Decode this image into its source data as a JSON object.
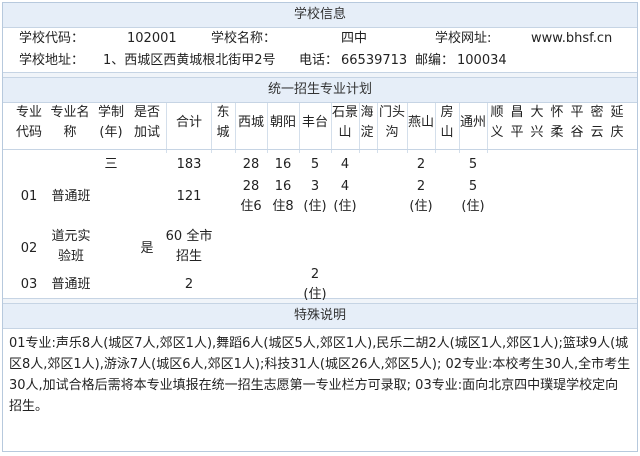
{
  "school_info": {
    "header": "学校信息",
    "code_label": "学校代码：",
    "code": "102001",
    "name_label": "学校名称：",
    "name": "四中",
    "url_label": "学校网址:",
    "url": "www.bhsf.cn",
    "address_label": "学校地址：",
    "address": "1、西城区西黄城根北街甲2号",
    "phone_label": "电话：",
    "phone": "66539713",
    "postal_label": "邮编：",
    "postal": "100034"
  },
  "plan": {
    "header": "统一招生专业计划",
    "columns": {
      "code": [
        "专业",
        "代码"
      ],
      "name": [
        "专业名",
        "称"
      ],
      "term": [
        "学制",
        "(年)"
      ],
      "exam": [
        "是否",
        "加试"
      ],
      "total": "合计",
      "dongcheng": [
        "东",
        "城"
      ],
      "xicheng": "西城",
      "chaoyang": "朝阳",
      "fengtai": "丰台",
      "shijingshan": [
        "石景",
        "山"
      ],
      "haidian": [
        "海",
        "淀"
      ],
      "mentougou": [
        "门头",
        "沟"
      ],
      "yanshan": [
        "燕山"
      ],
      "fangshan": [
        "房",
        "山"
      ],
      "tongzhou": "通州",
      "shunyi": [
        "顺",
        "义"
      ],
      "changping": [
        "昌",
        "平"
      ],
      "daxing": [
        "大",
        "兴"
      ],
      "huairou": [
        "怀",
        "柔"
      ],
      "pinggu": [
        "平",
        "谷"
      ],
      "miyun": [
        "密",
        "云"
      ],
      "yanqing": [
        "延",
        "庆"
      ]
    },
    "term_all": "三",
    "total_all": "183",
    "xicheng_all": "28",
    "chaoyang_all": "16",
    "fengtai_all": "5",
    "shijingshan_all": "4",
    "yanshan_all": "2",
    "tongzhou_all": "5",
    "rows": [
      {
        "code": "01",
        "name": "普通班",
        "total": "121",
        "xicheng": [
          "28",
          "住6"
        ],
        "chaoyang": [
          "16",
          "住8"
        ],
        "fengtai": [
          "3",
          "(住)"
        ],
        "shijingshan": [
          "4",
          "(住)"
        ],
        "yanshan": [
          "2",
          "(住)"
        ],
        "tongzhou": [
          "5",
          "(住)"
        ]
      },
      {
        "code": "02",
        "name": [
          "道元实",
          "验班"
        ],
        "exam": "是",
        "total": [
          "60 全市",
          "招生"
        ]
      },
      {
        "code": "03",
        "name": "普通班",
        "total": "2",
        "fengtai": [
          "2",
          "(住)"
        ]
      }
    ]
  },
  "notes": {
    "header": "特殊说明",
    "text": "01专业:声乐8人(城区7人,郊区1人),舞蹈6人(城区5人,郊区1人),民乐二胡2人(城区1人,郊区1人);篮球9人(城区8人,郊区1人),游泳7人(城区6人,郊区1人);科技31人(城区26人,郊区5人); 02专业:本校考生30人,全市考生30人,加试合格后需将本专业填报在统一招生志愿第一专业栏方可录取; 03专业:面向北京四中璞瑅学校定向招生。"
  }
}
